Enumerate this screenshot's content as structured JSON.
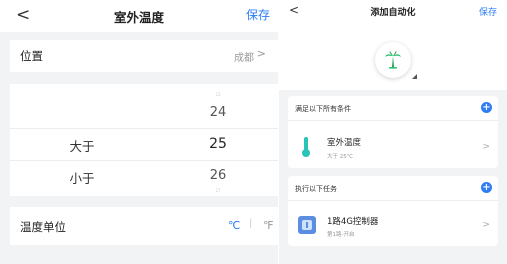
{
  "left": {
    "nav": {
      "back": "<",
      "title": "室外温度",
      "save": "保存"
    },
    "location": {
      "label": "位置",
      "value": "成都",
      "chevron": ">"
    },
    "picker": {
      "faint_top": "23",
      "values": [
        "24",
        "25",
        "26"
      ],
      "faint_bottom": "27",
      "comparators": [
        "大于",
        "小于"
      ]
    },
    "unit": {
      "label": "温度单位",
      "celsius": "℃",
      "separator": "|",
      "fahrenheit": "℉"
    }
  },
  "right": {
    "nav": {
      "back": "<",
      "title": "添加自动化",
      "save": "保存"
    },
    "scene_icon": "palm-tree-icon",
    "conditions": {
      "header": "满足以下所有条件",
      "plus": "+",
      "item": {
        "icon": "thermometer-icon",
        "title": "室外温度",
        "subtitle": "大于 25℃",
        "chevron": ">"
      }
    },
    "tasks": {
      "header": "执行以下任务",
      "plus": "+",
      "item": {
        "icon": "controller-icon",
        "title": "1路4G控制器",
        "subtitle": "第1路-开启",
        "chevron": ">"
      }
    }
  },
  "colors": {
    "accent": "#2d7cf6",
    "teal": "#29c3b8",
    "device": "#5b8de0"
  }
}
